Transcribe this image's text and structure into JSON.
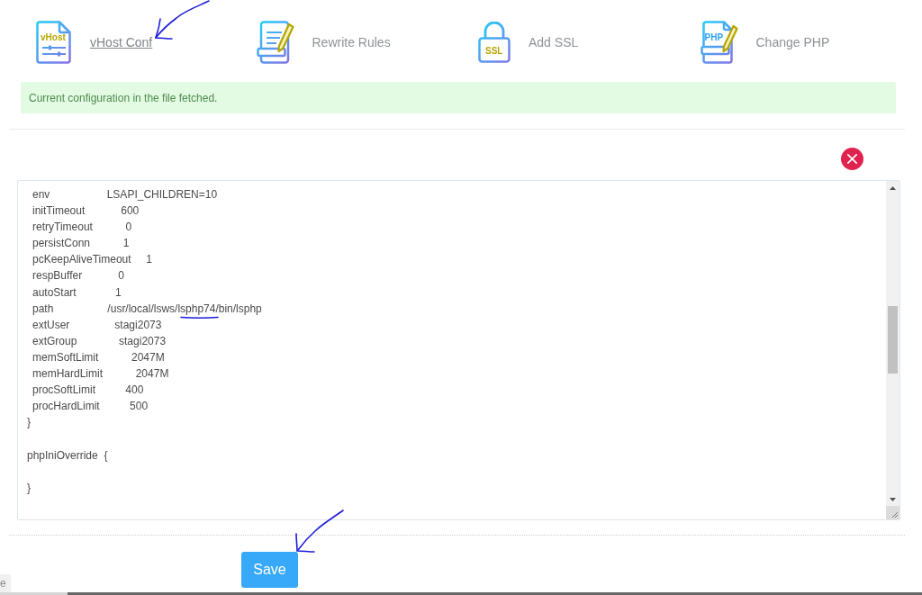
{
  "tools": [
    {
      "kind": "config",
      "icon_text": "vHost",
      "label": "vHost Conf",
      "hovered": true
    },
    {
      "kind": "rewrite",
      "label": "Rewrite Rules",
      "hovered": false
    },
    {
      "kind": "ssl",
      "icon_text": "SSL",
      "label": "Add SSL",
      "hovered": false
    },
    {
      "kind": "php",
      "icon_text": "PHP",
      "label": "Change PHP",
      "hovered": false
    }
  ],
  "alert": {
    "message": "Current configuration in the file fetched."
  },
  "editor": {
    "lines": [
      {
        "kind": "entry",
        "text": "env                   LSAPI_CHILDREN=10"
      },
      {
        "kind": "entry",
        "text": "initTimeout            600"
      },
      {
        "kind": "entry",
        "text": "retryTimeout           0"
      },
      {
        "kind": "entry",
        "text": "persistConn           1"
      },
      {
        "kind": "entry",
        "text": "pcKeepAliveTimeout     1"
      },
      {
        "kind": "entry",
        "text": "respBuffer            0"
      },
      {
        "kind": "entry",
        "text": "autoStart             1"
      },
      {
        "kind": "entry",
        "text": "path                  /usr/local/lsws/lsphp74/bin/lsphp"
      },
      {
        "kind": "entry",
        "text": "extUser               stagi2073"
      },
      {
        "kind": "entry",
        "text": "extGroup              stagi2073"
      },
      {
        "kind": "entry",
        "text": "memSoftLimit           2047M"
      },
      {
        "kind": "entry",
        "text": "memHardLimit           2047M"
      },
      {
        "kind": "entry",
        "text": "procSoftLimit          400"
      },
      {
        "kind": "entry",
        "text": "procHardLimit          500"
      },
      {
        "kind": "text",
        "text": "}"
      },
      {
        "kind": "blank"
      },
      {
        "kind": "text",
        "text": "phpIniOverride  {"
      },
      {
        "kind": "blank"
      },
      {
        "kind": "text",
        "text": "}"
      },
      {
        "kind": "blank"
      }
    ]
  },
  "save_button": {
    "label": "Save"
  },
  "side_tab": {
    "label": "e"
  }
}
